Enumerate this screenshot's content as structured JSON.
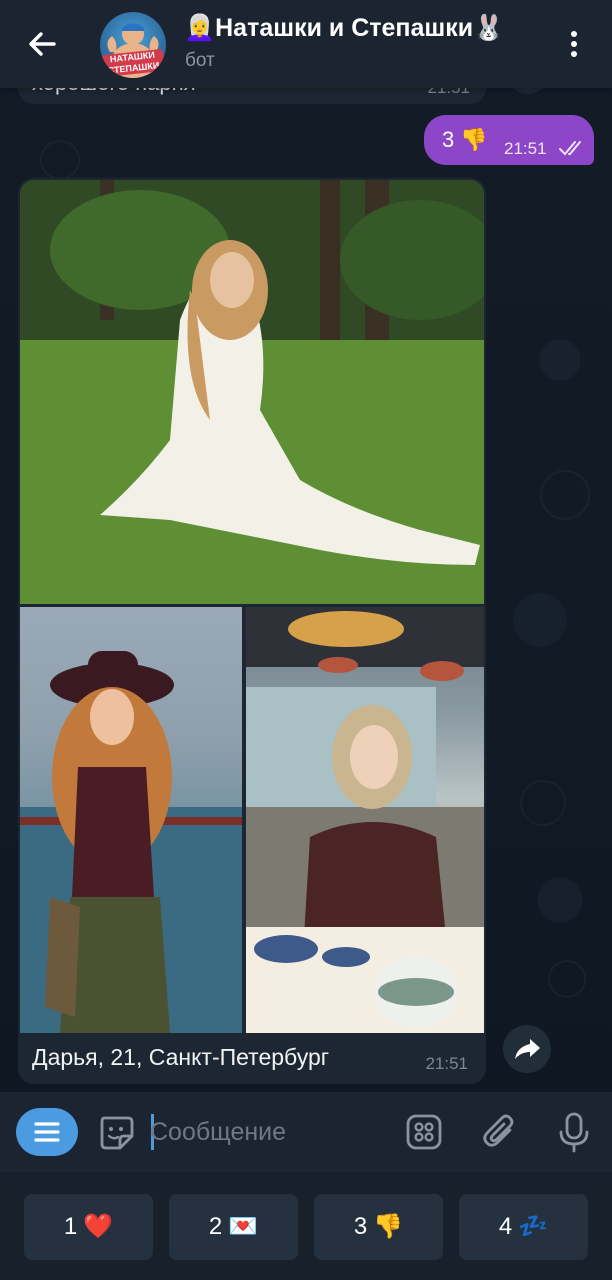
{
  "header": {
    "title": "👩‍🦳Наташки и Степашки🐰",
    "subtitle": "бот",
    "avatar_text": "НАТАШКИ СТЕПАШКИ"
  },
  "messages": {
    "previous": {
      "text": "хорошего парня",
      "time": "21:51"
    },
    "outgoing": {
      "text": "3 👎",
      "time": "21:51"
    },
    "album": {
      "caption": "Дарья, 21, Санкт-Петербург",
      "time": "21:51"
    }
  },
  "composer": {
    "placeholder": "Сообщение"
  },
  "keyboard": {
    "buttons": [
      {
        "number": "1",
        "emoji": "❤️"
      },
      {
        "number": "2",
        "emoji": "💌"
      },
      {
        "number": "3",
        "emoji": "👎"
      },
      {
        "number": "4",
        "emoji": "💤"
      }
    ]
  },
  "colors": {
    "accent": "#4a9be0",
    "outgoing_bubble": "#8e46c9",
    "header_bg": "#1b2430",
    "bubble_bg": "#1d2733"
  }
}
